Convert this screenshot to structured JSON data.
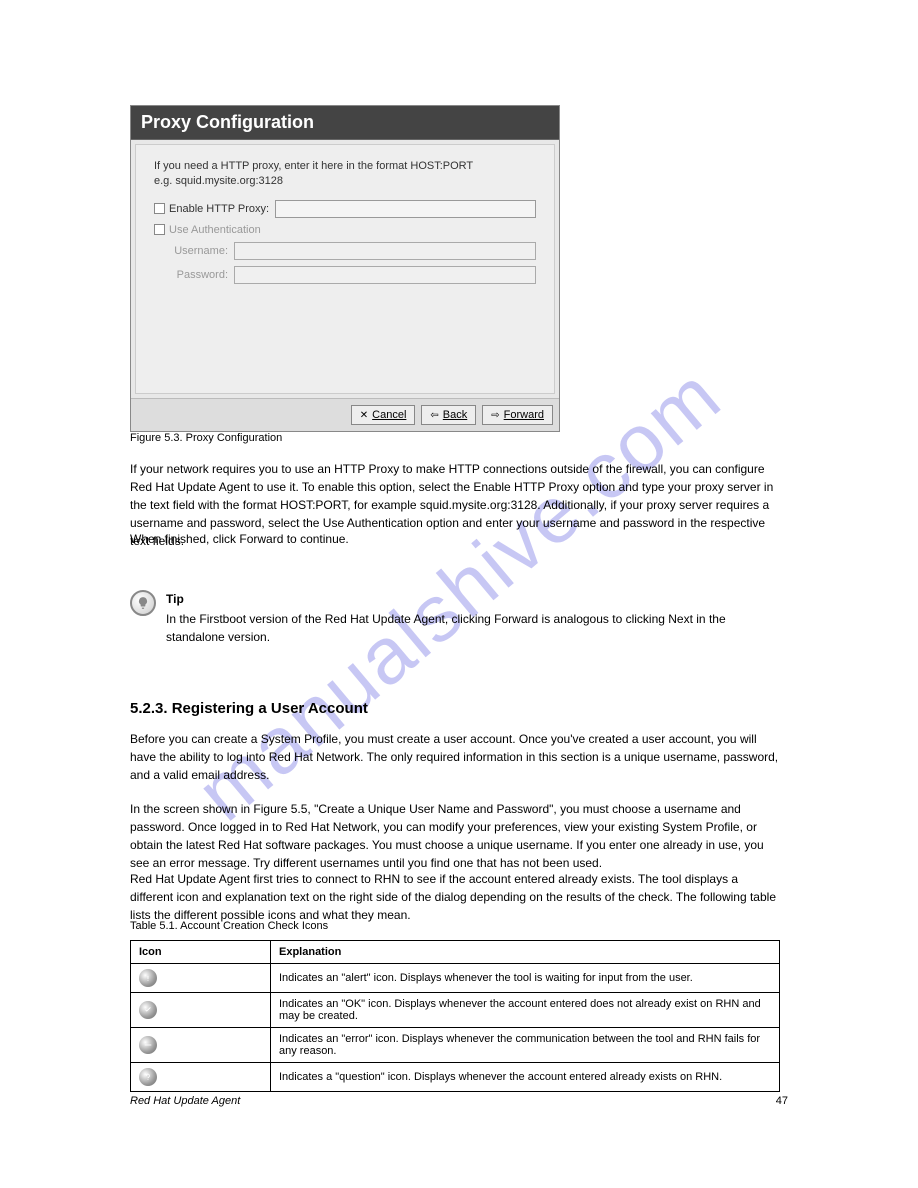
{
  "watermark": "manualshive.com",
  "dialog": {
    "title": "Proxy Configuration",
    "intro_line1": "If you need a HTTP proxy, enter it here in the format HOST:PORT",
    "intro_line2": "e.g. squid.mysite.org:3128",
    "enable_label": "Enable HTTP Proxy:",
    "auth_label": "Use Authentication",
    "username_label": "Username:",
    "password_label": "Password:",
    "buttons": {
      "cancel": "Cancel",
      "back": "Back",
      "forward": "Forward"
    }
  },
  "figure_caption": "Figure 5.3. Proxy Configuration",
  "para_proxy": "If your network requires you to use an HTTP Proxy to make HTTP connections outside of the firewall, you can configure Red Hat Update Agent to use it. To enable this option, select the Enable HTTP Proxy option and type your proxy server in the text field with the format HOST:PORT, for example squid.mysite.org:3128. Additionally, if your proxy server requires a username and password, select the Use Authentication option and enter your username and password in the respective text fields.",
  "para_forward": "When finished, click Forward to continue.",
  "tip": {
    "title": "Tip",
    "body": "In the Firstboot version of the Red Hat Update Agent, clicking Forward is analogous to clicking Next in the standalone version."
  },
  "section_title": "5.2.3. Registering a User Account",
  "para_reg1": "Before you can create a System Profile, you must create a user account. Once you've created a user account, you will have the ability to log into Red Hat Network. The only required information in this section is a unique username, password, and a valid email address.",
  "para_reg2": "In the screen shown in Figure 5.5, \"Create a Unique User Name and Password\", you must choose a username and password. Once logged in to Red Hat Network, you can modify your preferences, view your existing System Profile, or obtain the latest Red Hat software packages. You must choose a unique username. If you enter one already in use, you see an error message. Try different usernames until you find one that has not been used.",
  "para_reg3": "Red Hat Update Agent first tries to connect to RHN to see if the account entered already exists. The tool displays a different icon and explanation text on the right side of the dialog depending on the results of the check. The following table lists the different possible icons and what they mean.",
  "table_caption": "Table 5.1. Account Creation Check Icons",
  "table": {
    "header_icon": "Icon",
    "header_desc": "Explanation",
    "rows": [
      {
        "icon": "alert",
        "desc": "Indicates an \"alert\" icon. Displays whenever the tool is waiting for input from the user."
      },
      {
        "icon": "ok",
        "desc": "Indicates an \"OK\" icon. Displays whenever the account entered does not already exist on RHN and may be created."
      },
      {
        "icon": "error",
        "desc": "Indicates an \"error\" icon. Displays whenever the communication between the tool and RHN fails for any reason."
      },
      {
        "icon": "question",
        "desc": "Indicates a \"question\" icon. Displays whenever the account entered already exists on RHN."
      }
    ]
  },
  "footer_left": "Red Hat Update Agent",
  "footer_right": "47"
}
